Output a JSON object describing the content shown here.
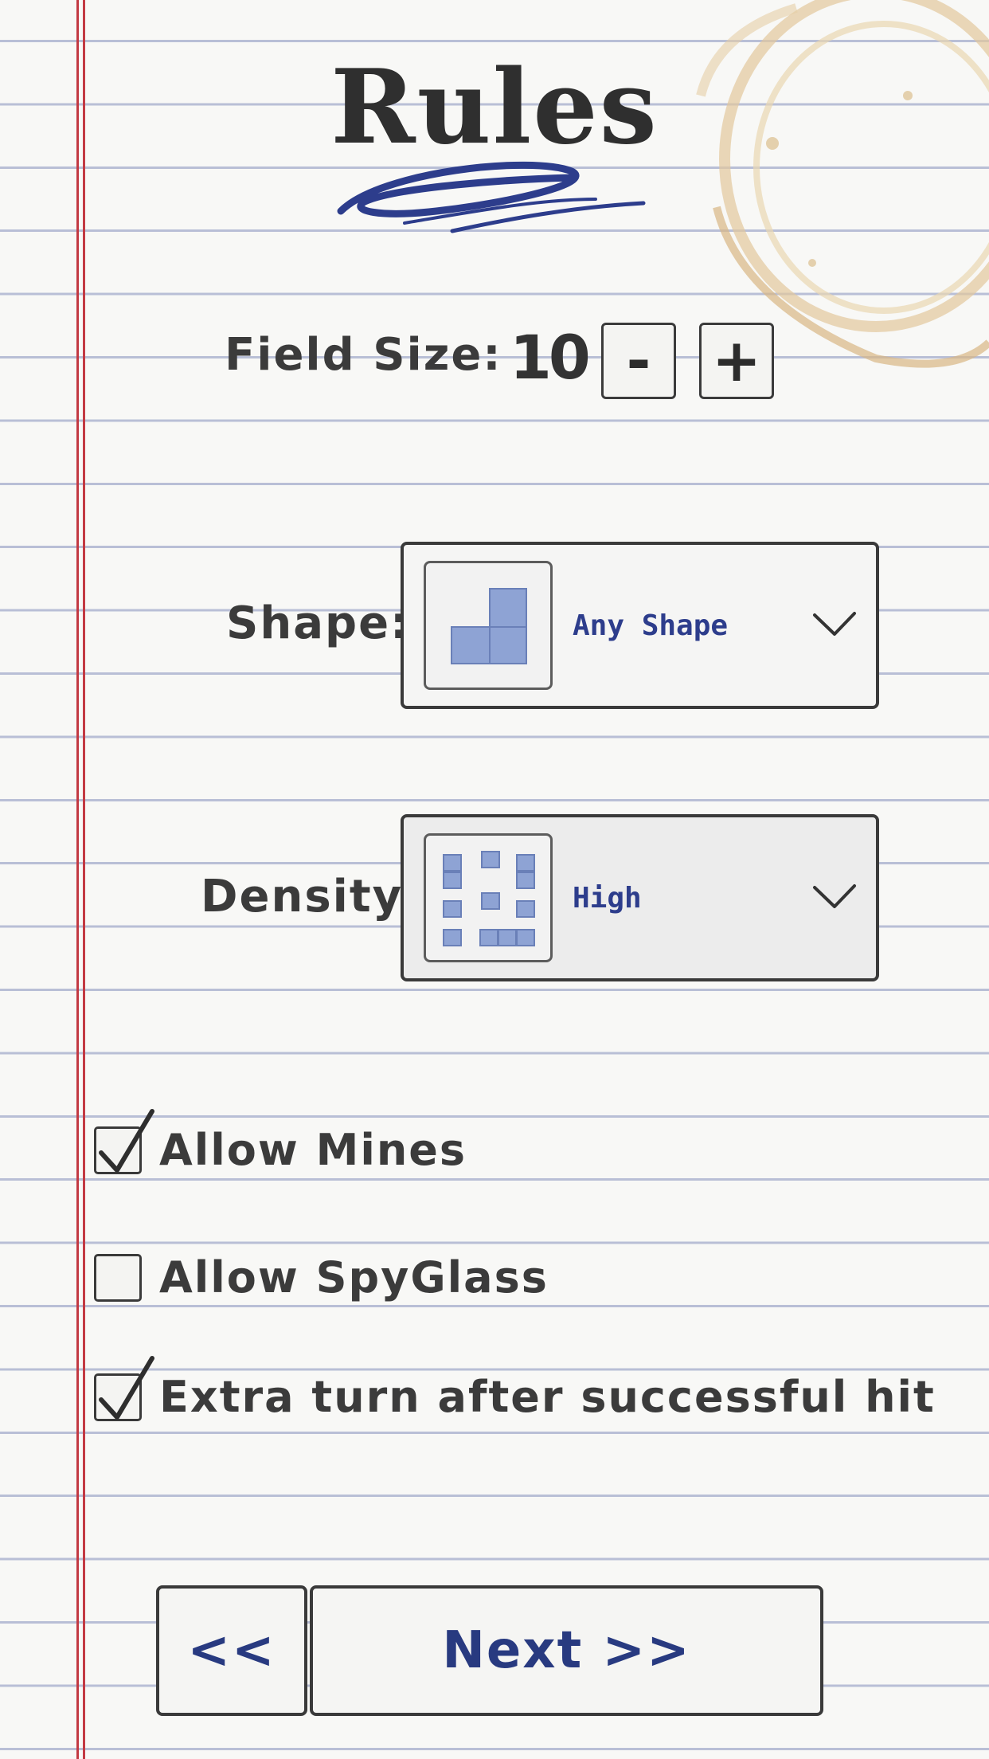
{
  "title": "Rules",
  "field_size": {
    "label": "Field Size:",
    "value": "10",
    "minus": "-",
    "plus": "+"
  },
  "shape": {
    "label": "Shape:",
    "selected": "Any Shape"
  },
  "density": {
    "label": "Density:",
    "selected": "High"
  },
  "options": [
    {
      "label": "Allow Mines",
      "checked": true
    },
    {
      "label": "Allow SpyGlass",
      "checked": false
    },
    {
      "label": "Extra turn after successful hit",
      "checked": true
    }
  ],
  "nav": {
    "back_label": "<<",
    "next_label": "Next >>"
  },
  "colors": {
    "ink_blue": "#2d3d8c",
    "margin_red": "#c33a43",
    "cell_blue": "#8ea3d4"
  }
}
